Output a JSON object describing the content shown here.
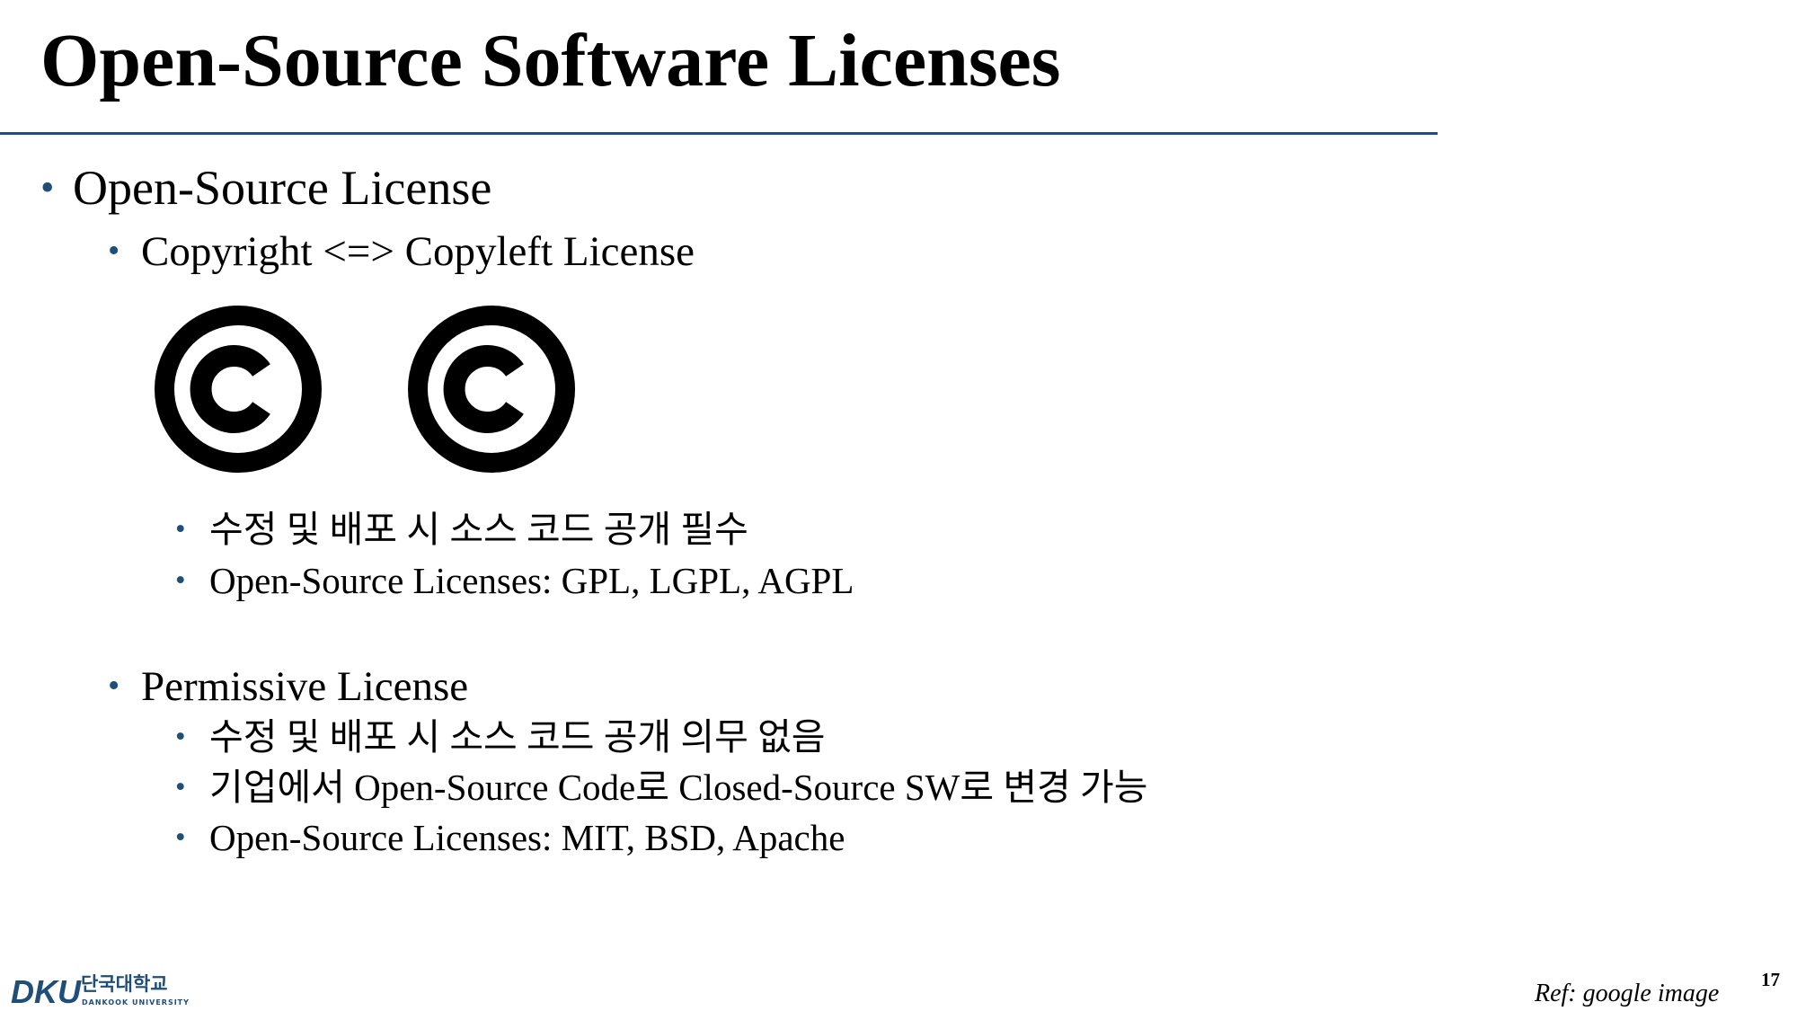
{
  "slide": {
    "title": "Open-Source Software Licenses",
    "page_number": "17",
    "reference": "Ref: google image"
  },
  "bullets": {
    "b1": "Open-Source License",
    "b1_1": "Copyright <=> Copyleft License",
    "b1_1_1": "수정 및 배포 시 소스 코드 공개 필수",
    "b1_1_2": "Open-Source Licenses: GPL, LGPL, AGPL",
    "b1_2": "Permissive License",
    "b1_2_1": "수정 및 배포 시 소스 코드 공개 의무 없음",
    "b1_2_2": "기업에서 Open-Source Code로 Closed-Source SW로 변경 가능",
    "b1_2_3": "Open-Source Licenses: MIT, BSD, Apache"
  },
  "logo": {
    "mark": "DKU",
    "korean_name": "단국대학교",
    "english_name": "DANKOOK UNIVERSITY",
    "color": "#1f4e79"
  },
  "theme": {
    "accent": "#1f4e79",
    "text": "#000000"
  },
  "icons": [
    "copyright-icon",
    "copyleft-icon"
  ]
}
